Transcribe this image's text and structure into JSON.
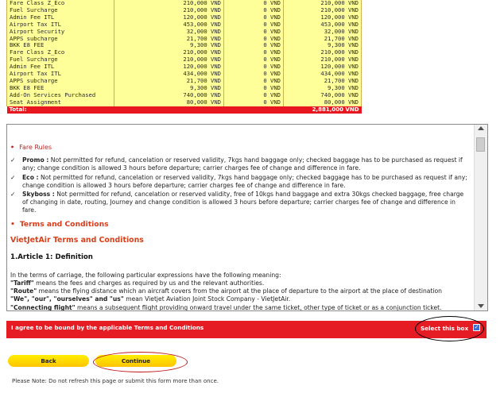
{
  "fare_table": {
    "rows": [
      {
        "item": "Fare Class Z_Eco",
        "base": "210,000 VND",
        "tax": "0 VND",
        "total": "210,000 VND"
      },
      {
        "item": "Fuel Surcharge",
        "base": "210,000 VND",
        "tax": "0 VND",
        "total": "210,000 VND"
      },
      {
        "item": "Admin Fee ITL",
        "base": "120,000 VND",
        "tax": "0 VND",
        "total": "120,000 VND"
      },
      {
        "item": "Airport Tax ITL",
        "base": "453,000 VND",
        "tax": "0 VND",
        "total": "453,000 VND"
      },
      {
        "item": "Airport Security",
        "base": "32,000 VND",
        "tax": "0 VND",
        "total": "32,000 VND"
      },
      {
        "item": "APPS subcharge",
        "base": "21,700 VND",
        "tax": "0 VND",
        "total": "21,700 VND"
      },
      {
        "item": "BKK E8 FEE",
        "base": "9,300 VND",
        "tax": "0 VND",
        "total": "9,300 VND"
      },
      {
        "item": "Fare Class Z_Eco",
        "base": "210,000 VND",
        "tax": "0 VND",
        "total": "210,000 VND"
      },
      {
        "item": "Fuel Surcharge",
        "base": "210,000 VND",
        "tax": "0 VND",
        "total": "210,000 VND"
      },
      {
        "item": "Admin Fee ITL",
        "base": "120,000 VND",
        "tax": "0 VND",
        "total": "120,000 VND"
      },
      {
        "item": "Airport Tax ITL",
        "base": "434,000 VND",
        "tax": "0 VND",
        "total": "434,000 VND"
      },
      {
        "item": "APPS subcharge",
        "base": "21,700 VND",
        "tax": "0 VND",
        "total": "21,700 VND"
      },
      {
        "item": "BKK E8 FEE",
        "base": "9,300 VND",
        "tax": "0 VND",
        "total": "9,300 VND"
      },
      {
        "item": "Add-On Services Purchased",
        "base": "740,000 VND",
        "tax": "0 VND",
        "total": "740,000 VND"
      },
      {
        "item": "Seat Assignment",
        "base": "80,000 VND",
        "tax": "0 VND",
        "total": "80,000 VND"
      }
    ],
    "total_label": "Total:",
    "total_value": "2,881,000 VND"
  },
  "terms": {
    "fare_rules_heading": "Fare Rules",
    "rules": [
      {
        "name": "Promo :",
        "text": "Not permitted for refund, cancelation or reserved validity, 7kgs hand baggage only; checked baggage has to be purchased as request if any; change condition is allowed 3 hours before departure; carrier charges fee of change and difference in fare."
      },
      {
        "name": "Eco :",
        "text": "Not permitted for refund, cancelation or reserved validity, 7kgs hand baggage only; checked baggage has to be purchased as request if any; change condition is allowed 3 hours before departure; carrier charges fee of change and difference in fare."
      },
      {
        "name": "Skyboss :",
        "text": "Not permitted for refund, cancelation or reserved validity, free of 10kgs hand baggage and extra 30kgs checked baggage, free charge of changing in date, routing, Journey and change condition is allowed 3 hours before departure; carrier charges fee of change and difference in fare."
      }
    ],
    "tc_heading": "Terms and Conditions",
    "vj_title": "VietJetAir Terms and Conditions",
    "article_title": "1.Article 1: Definition",
    "intro": "In the terms of carriage, the following particular expressions have the following meaning:",
    "defs": [
      {
        "term": "\"Tariff\"",
        "text": " means the fees and charges as required by us and the relevant authorities."
      },
      {
        "term": "\"Route\"",
        "text": " means the flying distance which an aircraft covers from the airport at the place of departure to the airport at the place of destination"
      },
      {
        "term": "\"We\", \"our\", \"ourselves\" and \"us\"",
        "text": " mean Vietjet Aviation Joint Stock Company - VietJetAir."
      },
      {
        "term": "\"Connecting flight\"",
        "text": " means a subsequent flight providing onward travel under the same ticket, other type of ticket or as a conjunction ticket."
      }
    ]
  },
  "agree": {
    "text": "I agree to be bound by the applicable Terms and Conditions",
    "select_label": "Select this box",
    "checked": true
  },
  "buttons": {
    "back": "Back",
    "continue": "Continue"
  },
  "note": "Please Note: Do not refresh this page or submit this form more than once.",
  "colors": {
    "table_bg": "#ffff99",
    "accent_red": "#e51c23",
    "button_yellow": "#ffdd00"
  }
}
